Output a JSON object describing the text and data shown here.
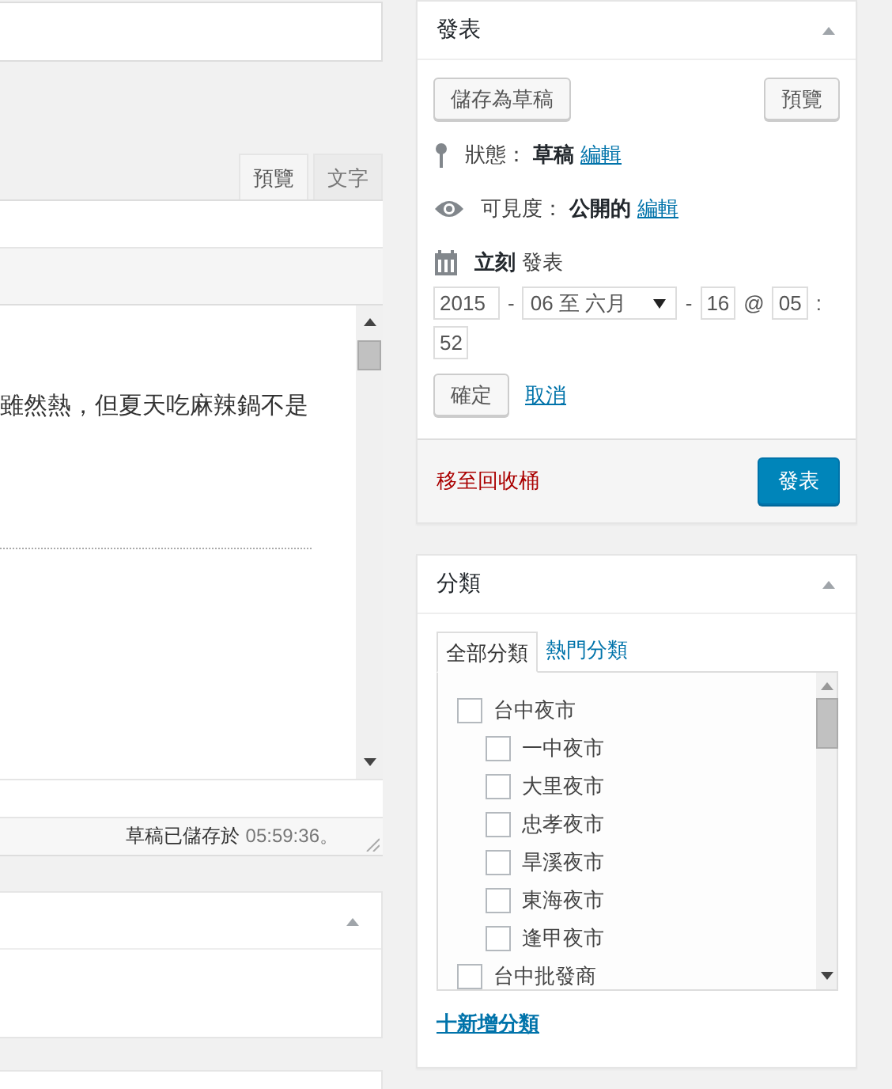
{
  "editor": {
    "tabs": [
      {
        "label": "預覽",
        "selected": true
      },
      {
        "label": "文字",
        "selected": false
      }
    ],
    "content_line": "雖然熱，但夏天吃麻辣鍋不是",
    "status_label": "草稿已儲存於",
    "saved_time": "05:59:36。"
  },
  "publish": {
    "title": "發表",
    "save_draft": "儲存為草稿",
    "preview": "預覽",
    "status": {
      "label": "狀態：",
      "value": "草稿",
      "edit": "編輯"
    },
    "visibility": {
      "label": "可見度：",
      "value": "公開的",
      "edit": "編輯"
    },
    "schedule": {
      "value": "立刻",
      "label": "發表"
    },
    "date_parts": [
      {
        "kind": "field",
        "text": "2015"
      },
      {
        "kind": "sep",
        "text": "-"
      },
      {
        "kind": "select",
        "text": "06 至 六月"
      },
      {
        "kind": "sep",
        "text": "-"
      },
      {
        "kind": "field",
        "text": "16"
      },
      {
        "kind": "sep",
        "text": "@"
      },
      {
        "kind": "field",
        "text": "05"
      },
      {
        "kind": "sep",
        "text": ":"
      },
      {
        "kind": "field",
        "text": "52"
      }
    ],
    "ok": "確定",
    "cancel": "取消",
    "trash": "移至回收桶",
    "publish_button": "發表"
  },
  "categories": {
    "title": "分類",
    "tabs": [
      {
        "label": "全部分類",
        "selected": true
      },
      {
        "label": "熱門分類",
        "selected": false
      }
    ],
    "items": [
      {
        "label": "台中夜市",
        "checked": false,
        "children": [
          {
            "label": "一中夜市",
            "checked": false
          },
          {
            "label": "大里夜市",
            "checked": false
          },
          {
            "label": "忠孝夜市",
            "checked": false
          },
          {
            "label": "旱溪夜市",
            "checked": false
          },
          {
            "label": "東海夜市",
            "checked": false
          },
          {
            "label": "逢甲夜市",
            "checked": false
          }
        ]
      },
      {
        "label": "台中批發商",
        "checked": false
      }
    ],
    "add_link": "十新增分類"
  }
}
